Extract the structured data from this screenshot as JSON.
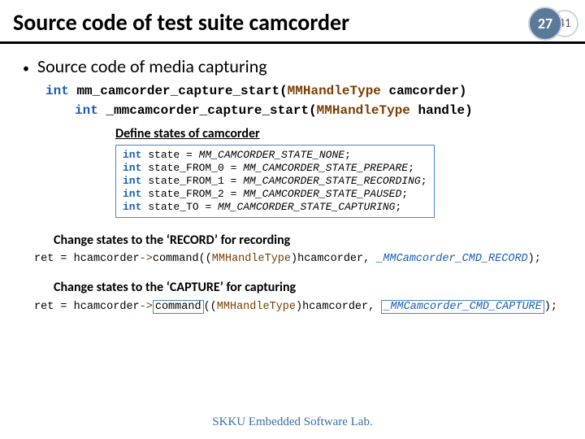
{
  "title": "Source code of test suite camcorder",
  "page_main": "27",
  "page_sub": "41",
  "bullet": "Source code of media capturing",
  "sig1": {
    "kw": "int",
    "fn": "mm_camcorder_capture_start",
    "type": "MMHandleType",
    "arg": "camcorder"
  },
  "sig2": {
    "kw": "int",
    "fn": "_mmcamcorder_capture_start",
    "type": "MMHandleType",
    "arg": "handle"
  },
  "states_label": "Define states of camcorder",
  "states": [
    {
      "kw": "int",
      "var": "state",
      "val": "MM_CAMCORDER_STATE_NONE"
    },
    {
      "kw": "int",
      "var": "state_FROM_0",
      "val": "MM_CAMCORDER_STATE_PREPARE"
    },
    {
      "kw": "int",
      "var": "state_FROM_1",
      "val": "MM_CAMCORDER_STATE_RECORDING"
    },
    {
      "kw": "int",
      "var": "state_FROM_2",
      "val": "MM_CAMCORDER_STATE_PAUSED"
    },
    {
      "kw": "int",
      "var": "state_TO",
      "val": "MM_CAMCORDER_STATE_CAPTURING"
    }
  ],
  "block1_label": "Change states to the ‘RECORD’ for recording",
  "code1": {
    "ret": "ret",
    "obj": "hcamcorder",
    "method": "command",
    "cast_type": "MMHandleType",
    "cast_arg": "hcamcorder",
    "cmd": "_MMCamcorder_CMD_RECORD"
  },
  "block2_label": "Change states to the ‘CAPTURE’ for capturing",
  "code2": {
    "ret": "ret",
    "obj": "hcamcorder",
    "method": "command",
    "cast_type": "MMHandleType",
    "cast_arg": "hcamcorder",
    "cmd": "_MMCamcorder_CMD_CAPTURE"
  },
  "footer": "SKKU Embedded Software Lab."
}
